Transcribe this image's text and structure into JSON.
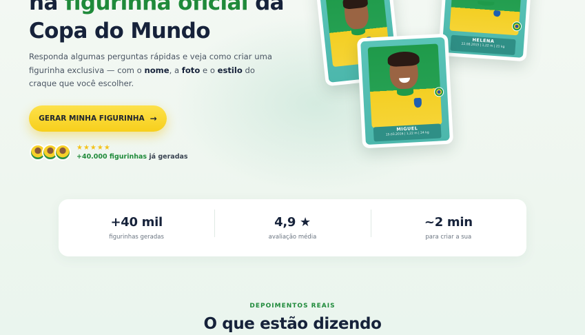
{
  "hero": {
    "title_line1_part1": "na ",
    "title_line1_highlight": "figurinha oficial",
    "title_line1_part2": " da",
    "title_line2": "Copa do Mundo",
    "description_part1": "Responda algumas perguntas rápidas e veja como criar uma figurinha exclusiva — com o ",
    "description_bold1": "nome",
    "description_part2": ", a ",
    "description_bold2": "foto",
    "description_part3": " e o ",
    "description_bold3": "estilo",
    "description_part4": " do craque que você escolher.",
    "cta_label": "GERAR MINHA FIGURINHA",
    "cta_arrow": "→",
    "stars": "★★★★★",
    "social_highlight": "+40.000 figurinhas",
    "social_rest": " já geradas"
  },
  "cards": [
    {
      "name": "",
      "meta": "",
      "icon": "sticker-card"
    },
    {
      "name": "HELENA",
      "meta": "22.08.2015 | 1,22 m | 21 kg",
      "icon": "sticker-card"
    },
    {
      "name": "MIGUEL",
      "meta": "15.03.2016 | 1,22 m | 24 kg",
      "icon": "sticker-card"
    }
  ],
  "stats": [
    {
      "value": "+40 mil",
      "label": "figurinhas geradas"
    },
    {
      "value": "4,9 ★",
      "label": "avaliação média"
    },
    {
      "value": "~2 min",
      "label": "para criar a sua"
    }
  ],
  "testimonials": {
    "kicker": "DEPOIMENTOS REAIS",
    "title": "O que estão dizendo"
  },
  "colors": {
    "accent_green": "#1f8a3a",
    "cta_yellow": "#f7cf1c",
    "card_teal": "#4cb7ac",
    "text_dark": "#16223a"
  }
}
